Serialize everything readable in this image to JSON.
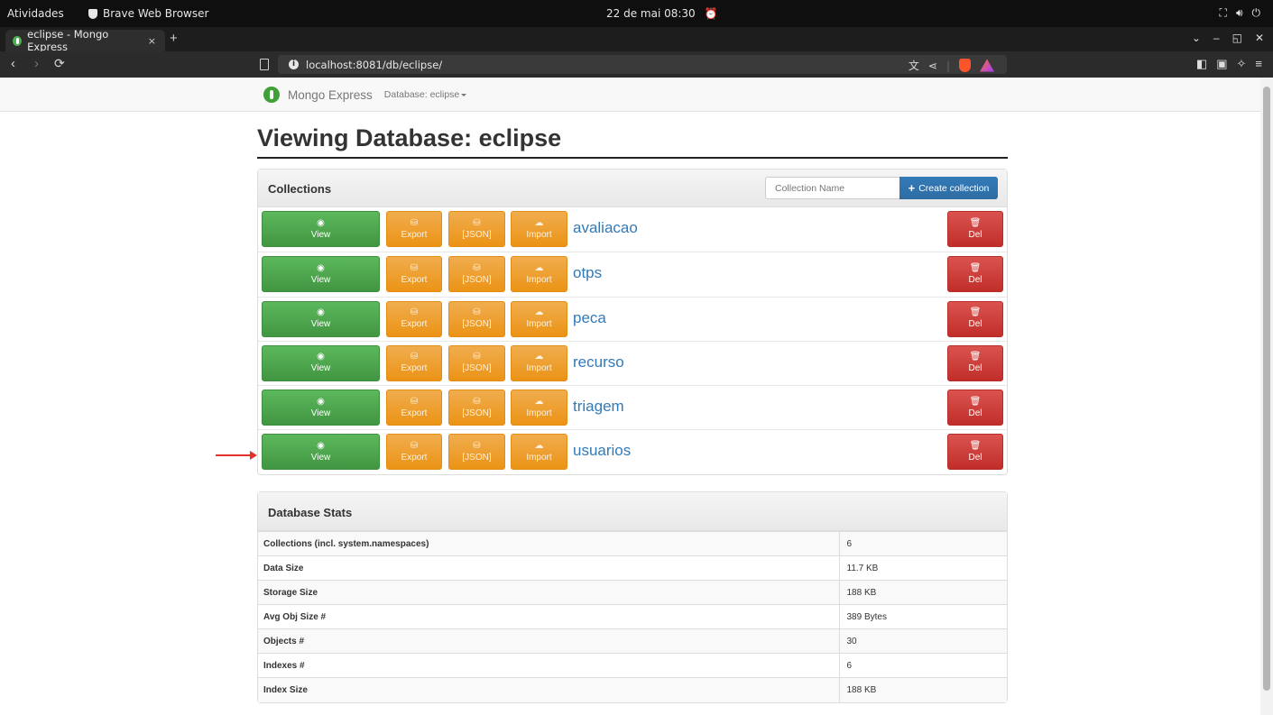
{
  "os": {
    "activities": "Atividades",
    "app_name": "Brave Web Browser",
    "clock": "22 de mai  08:30",
    "tray_icons": [
      "network-icon",
      "volume-icon",
      "power-icon"
    ]
  },
  "browser": {
    "tab_title": "eclipse - Mongo Express",
    "tab_close": "×",
    "new_tab": "+",
    "url": "localhost:8081/db/eclipse/",
    "window_controls": [
      "⌄",
      "–",
      "◱",
      "✕"
    ],
    "colors": {
      "shield": "#fb542b"
    }
  },
  "navbar": {
    "brand": "Mongo Express",
    "db_label": "Database: eclipse"
  },
  "page": {
    "title": "Viewing Database: eclipse"
  },
  "collections": {
    "header": "Collections",
    "input_placeholder": "Collection Name",
    "create_label": "Create collection",
    "buttons": {
      "view": "View",
      "export": "Export",
      "json": "[JSON]",
      "import": "Import",
      "del": "Del"
    },
    "items": [
      "avaliacao",
      "otps",
      "peca",
      "recurso",
      "triagem",
      "usuarios"
    ],
    "colors": {
      "view": "#5cb85c",
      "export": "#f0ad4e",
      "del": "#d9534f",
      "create": "#337ab7",
      "link": "#337ab7"
    }
  },
  "stats": {
    "header": "Database Stats",
    "rows": [
      {
        "label": "Collections (incl. system.namespaces)",
        "value": "6"
      },
      {
        "label": "Data Size",
        "value": "11.7 KB"
      },
      {
        "label": "Storage Size",
        "value": "188 KB"
      },
      {
        "label": "Avg Obj Size #",
        "value": "389 Bytes"
      },
      {
        "label": "Objects #",
        "value": "30"
      },
      {
        "label": "Indexes #",
        "value": "6"
      },
      {
        "label": "Index Size",
        "value": "188 KB"
      }
    ]
  }
}
